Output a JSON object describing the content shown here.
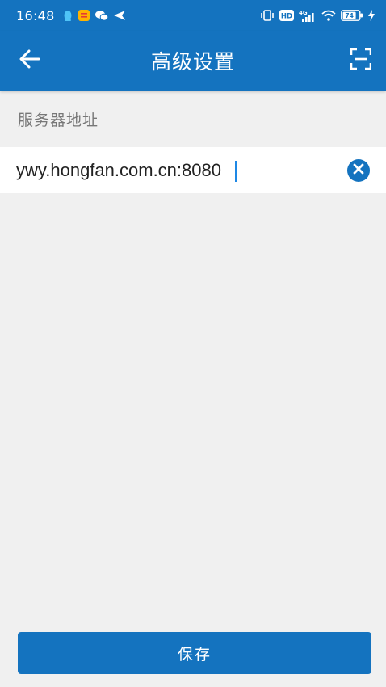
{
  "status_bar": {
    "time": "16:48",
    "network": "4G",
    "hd": "HD",
    "battery": "74",
    "left_icons": [
      "qq-icon",
      "note-app-icon",
      "wechat-icon",
      "send-icon"
    ],
    "right_icons": [
      "vibrate-icon",
      "hd-icon",
      "signal-4g-icon",
      "wifi-icon",
      "battery-icon",
      "charging-icon"
    ]
  },
  "app_bar": {
    "title": "高级设置",
    "back_icon": "arrow-back-icon",
    "scan_icon": "scan-icon"
  },
  "form": {
    "server_label": "服务器地址",
    "server_value": "ywy.hongfan.com.cn:8080",
    "clear_icon": "clear-icon"
  },
  "actions": {
    "save_label": "保存"
  },
  "colors": {
    "primary": "#1473bf",
    "background": "#f0f0f0",
    "input_bg": "#ffffff",
    "label": "#777777",
    "caret": "#1e88e5"
  }
}
